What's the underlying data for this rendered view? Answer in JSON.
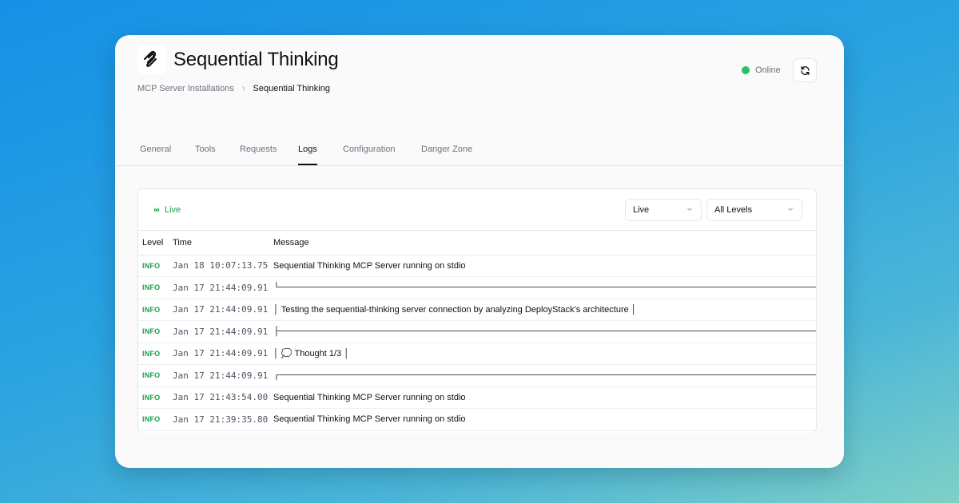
{
  "app": {
    "title": "Sequential Thinking",
    "status": "Online",
    "status_color": "#22c55e"
  },
  "breadcrumb": {
    "parent": "MCP Server Installations",
    "separator": "›",
    "current": "Sequential Thinking"
  },
  "tabs": [
    {
      "label": "General"
    },
    {
      "label": "Tools"
    },
    {
      "label": "Requests"
    },
    {
      "label": "Logs",
      "active": true
    },
    {
      "label": "Configuration"
    },
    {
      "label": "Danger Zone"
    }
  ],
  "logs": {
    "live_label": "Live",
    "mode_select": {
      "value": "Live"
    },
    "level_select": {
      "value": "All Levels"
    },
    "columns": [
      "Level",
      "Time",
      "Message"
    ],
    "rows": [
      {
        "level": "INFO",
        "time": "Jan 18 10:07:13.75",
        "message": "Sequential Thinking MCP Server running on stdio"
      },
      {
        "level": "INFO",
        "time": "Jan 17 21:44:09.91",
        "message": "└────────────────────────────────────────────────────────────────────────────────────────────────────────────────────────────────────────"
      },
      {
        "level": "INFO",
        "time": "Jan 17 21:44:09.91",
        "message": "│ Testing the sequential-thinking server connection by analyzing DeployStack's architecture │"
      },
      {
        "level": "INFO",
        "time": "Jan 17 21:44:09.91",
        "message": "├────────────────────────────────────────────────────────────────────────────────────────────────────────────────────────────────────────"
      },
      {
        "level": "INFO",
        "time": "Jan 17 21:44:09.91",
        "message": "│ 💭 Thought 1/3 │"
      },
      {
        "level": "INFO",
        "time": "Jan 17 21:44:09.91",
        "message": "┌────────────────────────────────────────────────────────────────────────────────────────────────────────────────────────────────────────"
      },
      {
        "level": "INFO",
        "time": "Jan 17 21:43:54.00",
        "message": "Sequential Thinking MCP Server running on stdio"
      },
      {
        "level": "INFO",
        "time": "Jan 17 21:39:35.80",
        "message": "Sequential Thinking MCP Server running on stdio"
      }
    ],
    "level_color": "#16a34a"
  }
}
